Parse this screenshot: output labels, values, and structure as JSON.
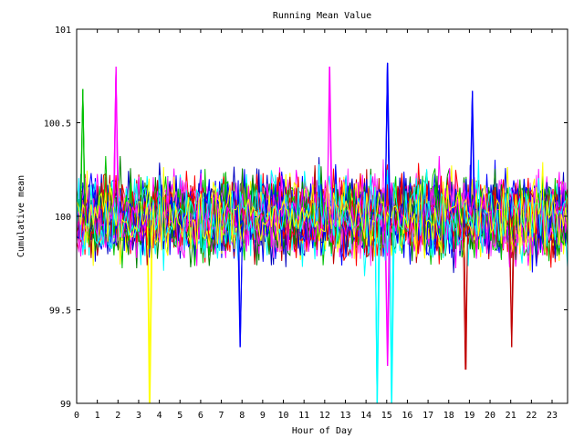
{
  "chart_data": {
    "type": "line",
    "title": "Running Mean Value",
    "xlabel": "Hour of Day",
    "ylabel": "Cumulative mean",
    "xlim": [
      0,
      23.75
    ],
    "ylim": [
      99,
      101
    ],
    "x_ticks": [
      "0",
      "1",
      "2",
      "3",
      "4",
      "5",
      "6",
      "7",
      "8",
      "9",
      "10",
      "11",
      "12",
      "13",
      "14",
      "15",
      "16",
      "17",
      "18",
      "19",
      "20",
      "21",
      "22",
      "23"
    ],
    "y_ticks": [
      "99",
      "99.5",
      "100",
      "100.5",
      "101"
    ],
    "grid": false,
    "legend": "none",
    "series_colors": [
      "#ff0000",
      "#00c000",
      "#0000ff",
      "#ff00ff",
      "#00ffff",
      "#ffff00",
      "#c00000",
      "#0000c0",
      "#ff40ff",
      "#008000"
    ],
    "series_count": 36,
    "samples_per_series": 238,
    "center_value": 100,
    "typical_spread": 0.17,
    "spikes": [
      {
        "x": 3.55,
        "y": 99.0,
        "color": "#ffff00"
      },
      {
        "x": 14.55,
        "y": 99.0,
        "color": "#00ffff"
      },
      {
        "x": 15.25,
        "y": 99.0,
        "color": "#00ffff"
      },
      {
        "x": 15.05,
        "y": 100.82,
        "color": "#0000ff"
      },
      {
        "x": 12.25,
        "y": 100.8,
        "color": "#ff00ff"
      },
      {
        "x": 1.9,
        "y": 100.8,
        "color": "#ff00ff"
      },
      {
        "x": 18.8,
        "y": 99.18,
        "color": "#c00000"
      },
      {
        "x": 15.05,
        "y": 99.2,
        "color": "#ff00ff"
      },
      {
        "x": 7.9,
        "y": 99.3,
        "color": "#0000ff"
      },
      {
        "x": 19.15,
        "y": 100.67,
        "color": "#0000ff"
      },
      {
        "x": 21.05,
        "y": 99.3,
        "color": "#c00000"
      },
      {
        "x": 0.3,
        "y": 100.68,
        "color": "#00c000"
      }
    ]
  }
}
